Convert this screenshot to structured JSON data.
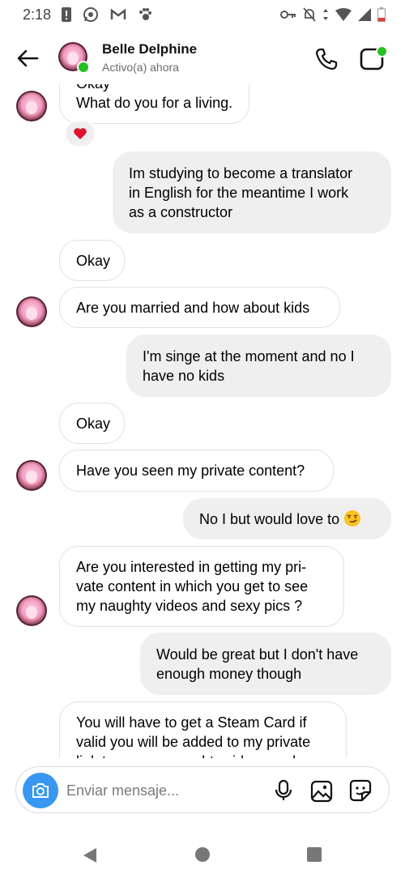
{
  "status_bar": {
    "time": "2:18"
  },
  "header": {
    "contact_name": "Belle Delphine",
    "contact_status": "Activo(a) ahora"
  },
  "messages": [
    {
      "side": "in",
      "text": "Okay"
    },
    {
      "side": "in",
      "text": "What do you for a living.",
      "reaction": "heart"
    },
    {
      "side": "out",
      "lines": [
        "Im studying to become a translator",
        "in English for the meantime I work",
        "as a constructor"
      ]
    },
    {
      "side": "in",
      "text": "Okay"
    },
    {
      "side": "in",
      "text": "Are you married and how about kids"
    },
    {
      "side": "out",
      "lines": [
        "I'm singe at the moment and no I",
        "have no kids"
      ]
    },
    {
      "side": "in",
      "text": "Okay"
    },
    {
      "side": "in",
      "text": "Have you seen my private content?"
    },
    {
      "side": "out",
      "text": "No I but would love to",
      "emoji": "smirk-emoji"
    },
    {
      "side": "in",
      "lines": [
        "Are you interested in getting my pri-",
        "vate content in which you get to see",
        "my naughty videos and sexy pics ?"
      ]
    },
    {
      "side": "out",
      "lines": [
        "Would be great but I don't have",
        "enough money though"
      ]
    },
    {
      "side": "in",
      "lines": [
        "You will have to get a Steam Card if",
        "valid you will be added to my private",
        "link to see my naughty videos and"
      ]
    }
  ],
  "composer": {
    "placeholder": "Enviar mensaje..."
  },
  "colors": {
    "accent": "#3897f0",
    "online": "#25c225",
    "heart": "#e0112f",
    "incoming_bg": "#ffffff",
    "outgoing_bg": "#efefef"
  },
  "icons": [
    "back-arrow-icon",
    "phone-icon",
    "video-call-icon",
    "camera-icon",
    "microphone-icon",
    "gallery-icon",
    "sticker-icon",
    "heart-icon"
  ]
}
